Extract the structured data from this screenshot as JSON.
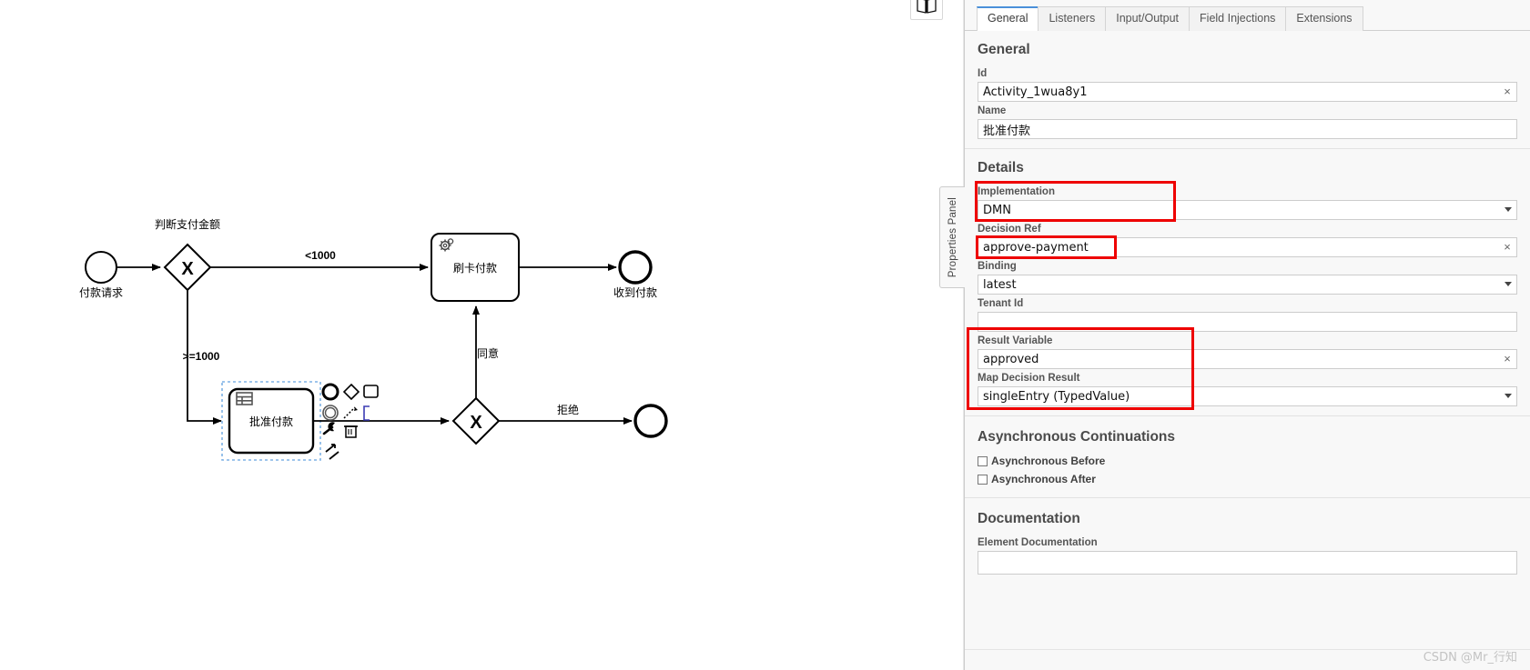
{
  "watermark": "CSDN @Mr_行知",
  "panel": {
    "handle_label": "Properties Panel",
    "map_icon": "book-map-icon",
    "tabs": [
      {
        "label": "General",
        "active": true
      },
      {
        "label": "Listeners",
        "active": false
      },
      {
        "label": "Input/Output",
        "active": false
      },
      {
        "label": "Field Injections",
        "active": false
      },
      {
        "label": "Extensions",
        "active": false
      }
    ],
    "groups": {
      "general": {
        "title": "General",
        "fields": [
          {
            "label": "Id",
            "value": "Activity_1wua8y1",
            "type": "text",
            "clearable": true
          },
          {
            "label": "Name",
            "value": "批准付款",
            "type": "text",
            "clearable": true
          }
        ]
      },
      "details": {
        "title": "Details",
        "implementation_label": "Implementation",
        "implementation_value": "DMN",
        "decision_ref_label": "Decision Ref",
        "decision_ref_value": "approve-payment",
        "binding_label": "Binding",
        "binding_value": "latest",
        "tenant_id_label": "Tenant Id",
        "tenant_id_value": "",
        "result_variable_label": "Result Variable",
        "result_variable_value": "approved",
        "map_decision_result_label": "Map Decision Result",
        "map_decision_result_value": "singleEntry (TypedValue)"
      },
      "async": {
        "title": "Asynchronous Continuations",
        "before_label": "Asynchronous Before",
        "before_checked": false,
        "after_label": "Asynchronous After",
        "after_checked": false
      },
      "documentation": {
        "title": "Documentation",
        "element_doc_label": "Element Documentation",
        "element_doc_value": ""
      }
    },
    "annotation_color": "#ee0000"
  },
  "diagram": {
    "start_event_label": "付款请求",
    "gateway1_label": "判断支付金额",
    "flow_lt1000_label": "<1000",
    "flow_gte1000_label": ">=1000",
    "service_task_label": "刷卡付款",
    "end_event1_label": "收到付款",
    "business_rule_task_label": "批准付款",
    "flow_agree_label": "同意",
    "flow_reject_label": "拒绝",
    "gateway2_label": "X",
    "gateway1_marker": "X",
    "context_pad": [
      {
        "name": "append-end-event",
        "glyph": "circle"
      },
      {
        "name": "append-gateway",
        "glyph": "diamond"
      },
      {
        "name": "append-task",
        "glyph": "square"
      },
      {
        "name": "append-intermediate-event",
        "glyph": "double-circle"
      },
      {
        "name": "connect-tool",
        "glyph": "connector"
      },
      {
        "name": "change-type-wrench",
        "glyph": "wrench"
      },
      {
        "name": "delete",
        "glyph": "trash"
      },
      {
        "name": "append-text-annotation",
        "glyph": "bracket"
      }
    ]
  }
}
